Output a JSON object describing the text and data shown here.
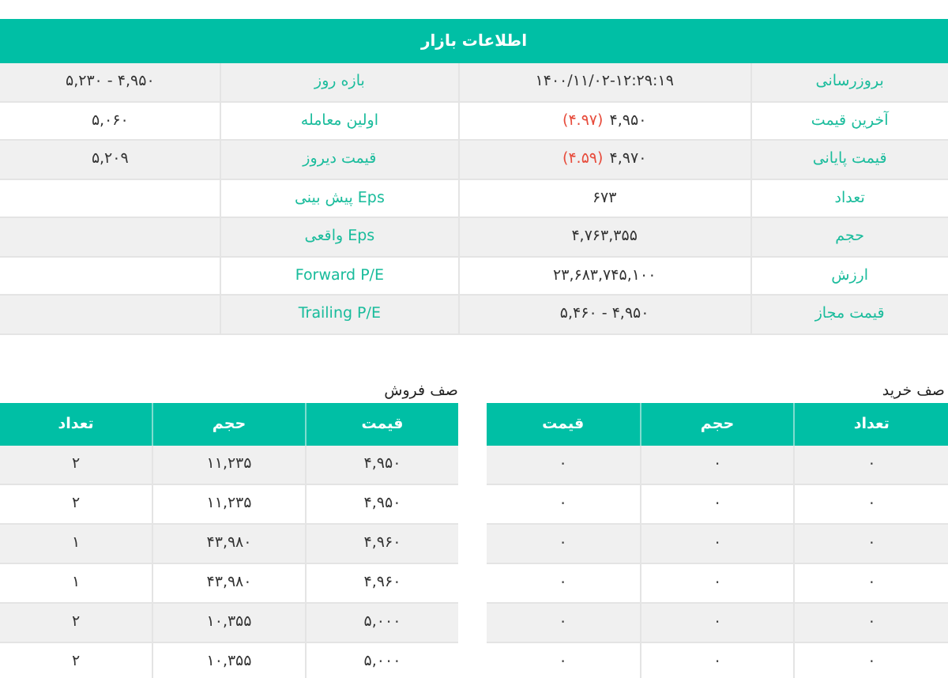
{
  "market_info": {
    "title": "اطلاعات بازار",
    "rows": [
      {
        "label": "بروزرسانی",
        "value": "۱۴۰۰/۱۱/۰۲-۱۲:۲۹:۱۹",
        "label_2": "بازه روز",
        "value_2": "۵,۲۳۰ - ۴,۹۵۰"
      },
      {
        "label": "آخرین قیمت",
        "value": "۴,۹۵۰",
        "change": "(۴.۹۷)",
        "label_2": "اولین معامله",
        "value_2": "۵,۰۶۰"
      },
      {
        "label": "قیمت پایانی",
        "value": "۴,۹۷۰",
        "change": "(۴.۵۹)",
        "label_2": "قیمت دیروز",
        "value_2": "۵,۲۰۹"
      },
      {
        "label": "تعداد",
        "value": "۶۷۳",
        "label_2": "Eps پیش بینی"
      },
      {
        "label": "حجم",
        "value": "۴,۷۶۳,۳۵۵",
        "label_2": "Eps واقعی"
      },
      {
        "label": "ارزش",
        "value": "۲۳,۶۸۳,۷۴۵,۱۰۰",
        "label_2": "Forward P/E"
      },
      {
        "label": "قیمت مجاز",
        "value": "۵,۴۶۰ - ۴,۹۵۰",
        "label_2": "Trailing P/E"
      }
    ]
  },
  "buy_queue": {
    "title": "صف خرید",
    "columns": [
      "تعداد",
      "حجم",
      "قیمت"
    ],
    "rows": [
      [
        "۰",
        "۰",
        "۰"
      ],
      [
        "۰",
        "۰",
        "۰"
      ],
      [
        "۰",
        "۰",
        "۰"
      ],
      [
        "۰",
        "۰",
        "۰"
      ],
      [
        "۰",
        "۰",
        "۰"
      ],
      [
        "۰",
        "۰",
        "۰"
      ]
    ]
  },
  "sell_queue": {
    "title": "صف فروش",
    "columns": [
      "قیمت",
      "حجم",
      "تعداد"
    ],
    "rows": [
      [
        "۴,۹۵۰",
        "۱۱,۲۳۵",
        "۲"
      ],
      [
        "۴,۹۵۰",
        "۱۱,۲۳۵",
        "۲"
      ],
      [
        "۴,۹۶۰",
        "۴۳,۹۸۰",
        "۱"
      ],
      [
        "۴,۹۶۰",
        "۴۳,۹۸۰",
        "۱"
      ],
      [
        "۵,۰۰۰",
        "۱۰,۳۵۵",
        "۲"
      ],
      [
        "۵,۰۰۰",
        "۱۰,۳۵۵",
        "۲"
      ]
    ]
  }
}
